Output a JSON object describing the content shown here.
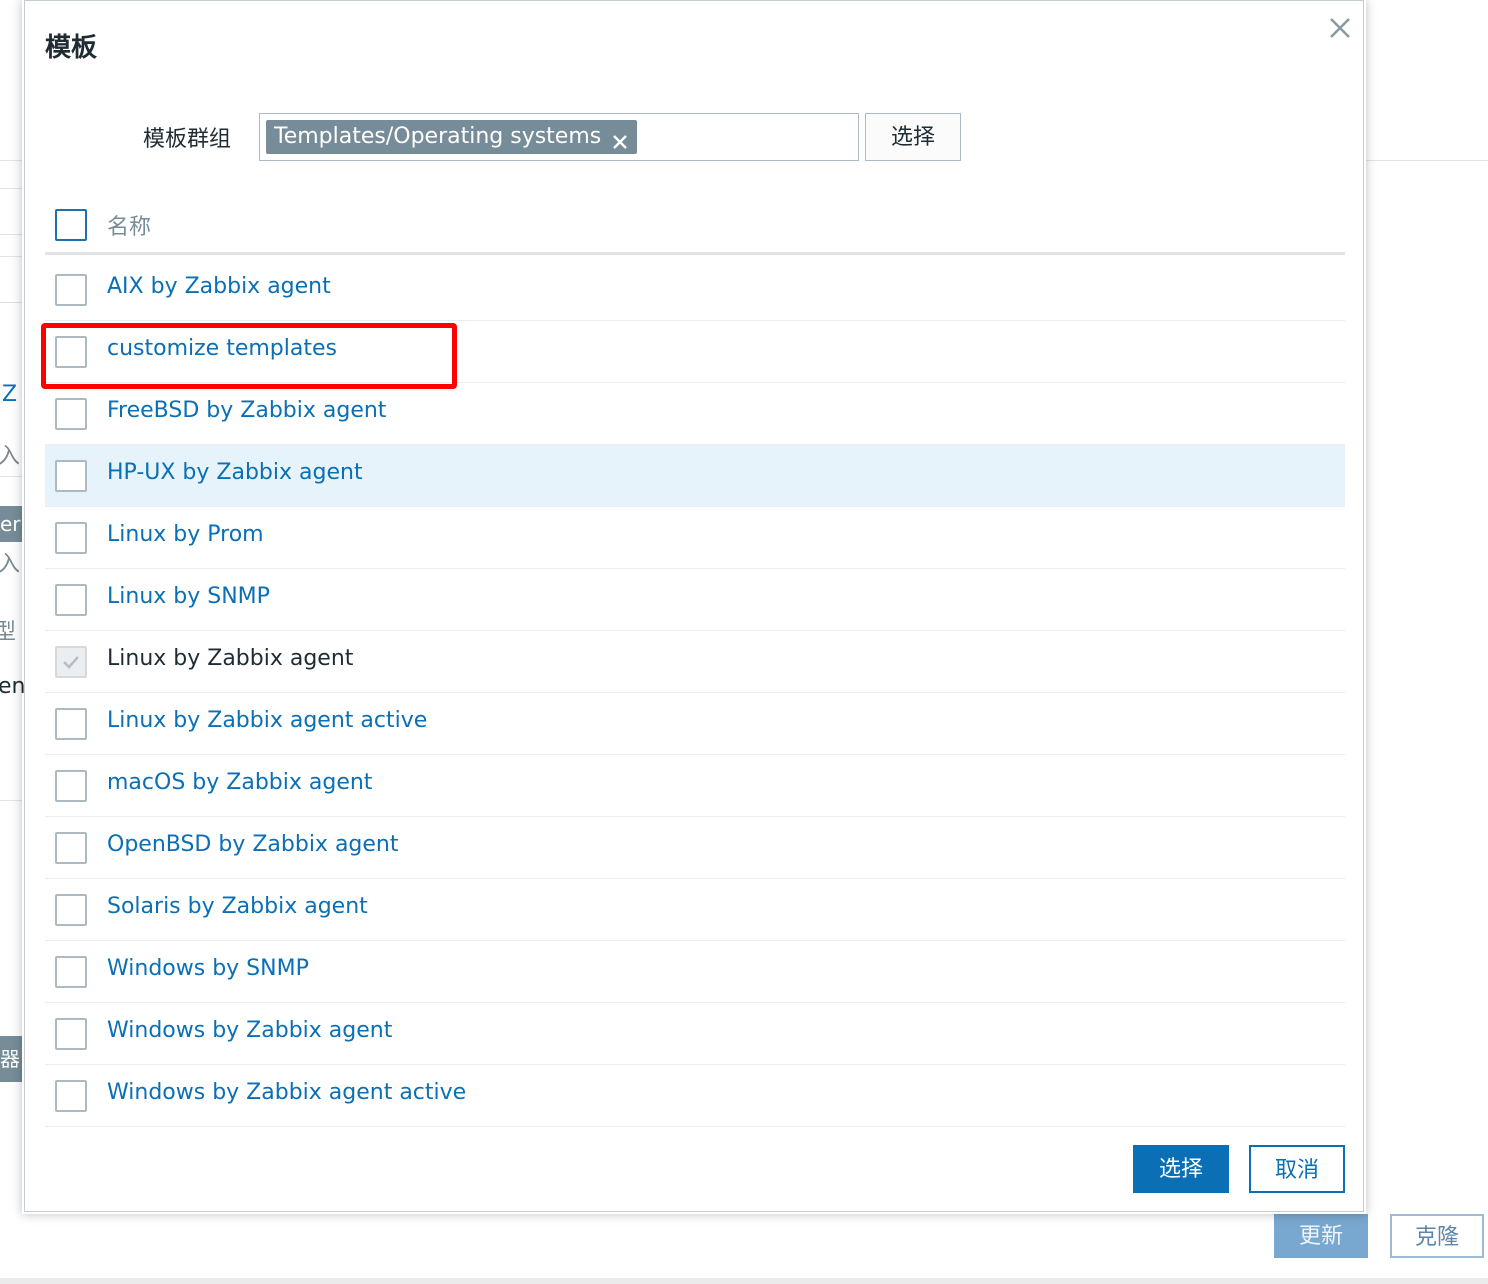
{
  "background": {
    "fragments": [
      "Z",
      "入",
      "er",
      "入",
      "型",
      "ent",
      "器"
    ],
    "update_button": "更新",
    "clone_button": "克隆"
  },
  "dialog": {
    "title": "模板",
    "filter": {
      "label": "模板群组",
      "selected_tag": "Templates/Operating systems",
      "select_button": "选择"
    },
    "list": {
      "header_name": "名称",
      "rows": [
        {
          "name": "AIX by Zabbix agent",
          "checked": false,
          "disabled": false
        },
        {
          "name": "customize templates",
          "checked": false,
          "disabled": false
        },
        {
          "name": "FreeBSD by Zabbix agent",
          "checked": false,
          "disabled": false
        },
        {
          "name": "HP-UX by Zabbix agent",
          "checked": false,
          "disabled": false,
          "hovered": true
        },
        {
          "name": "Linux by Prom",
          "checked": false,
          "disabled": false
        },
        {
          "name": "Linux by SNMP",
          "checked": false,
          "disabled": false
        },
        {
          "name": "Linux by Zabbix agent",
          "checked": true,
          "disabled": true
        },
        {
          "name": "Linux by Zabbix agent active",
          "checked": false,
          "disabled": false
        },
        {
          "name": "macOS by Zabbix agent",
          "checked": false,
          "disabled": false
        },
        {
          "name": "OpenBSD by Zabbix agent",
          "checked": false,
          "disabled": false
        },
        {
          "name": "Solaris by Zabbix agent",
          "checked": false,
          "disabled": false
        },
        {
          "name": "Windows by SNMP",
          "checked": false,
          "disabled": false
        },
        {
          "name": "Windows by Zabbix agent",
          "checked": false,
          "disabled": false
        },
        {
          "name": "Windows by Zabbix agent active",
          "checked": false,
          "disabled": false
        }
      ]
    },
    "footer": {
      "select_button": "选择",
      "cancel_button": "取消"
    }
  },
  "colors": {
    "link": "#0a6fb5",
    "primary_button": "#0a6fb5",
    "tag_background": "#768d99",
    "hover_row": "#e6f3fb",
    "highlight_annotation": "#ff0000"
  }
}
